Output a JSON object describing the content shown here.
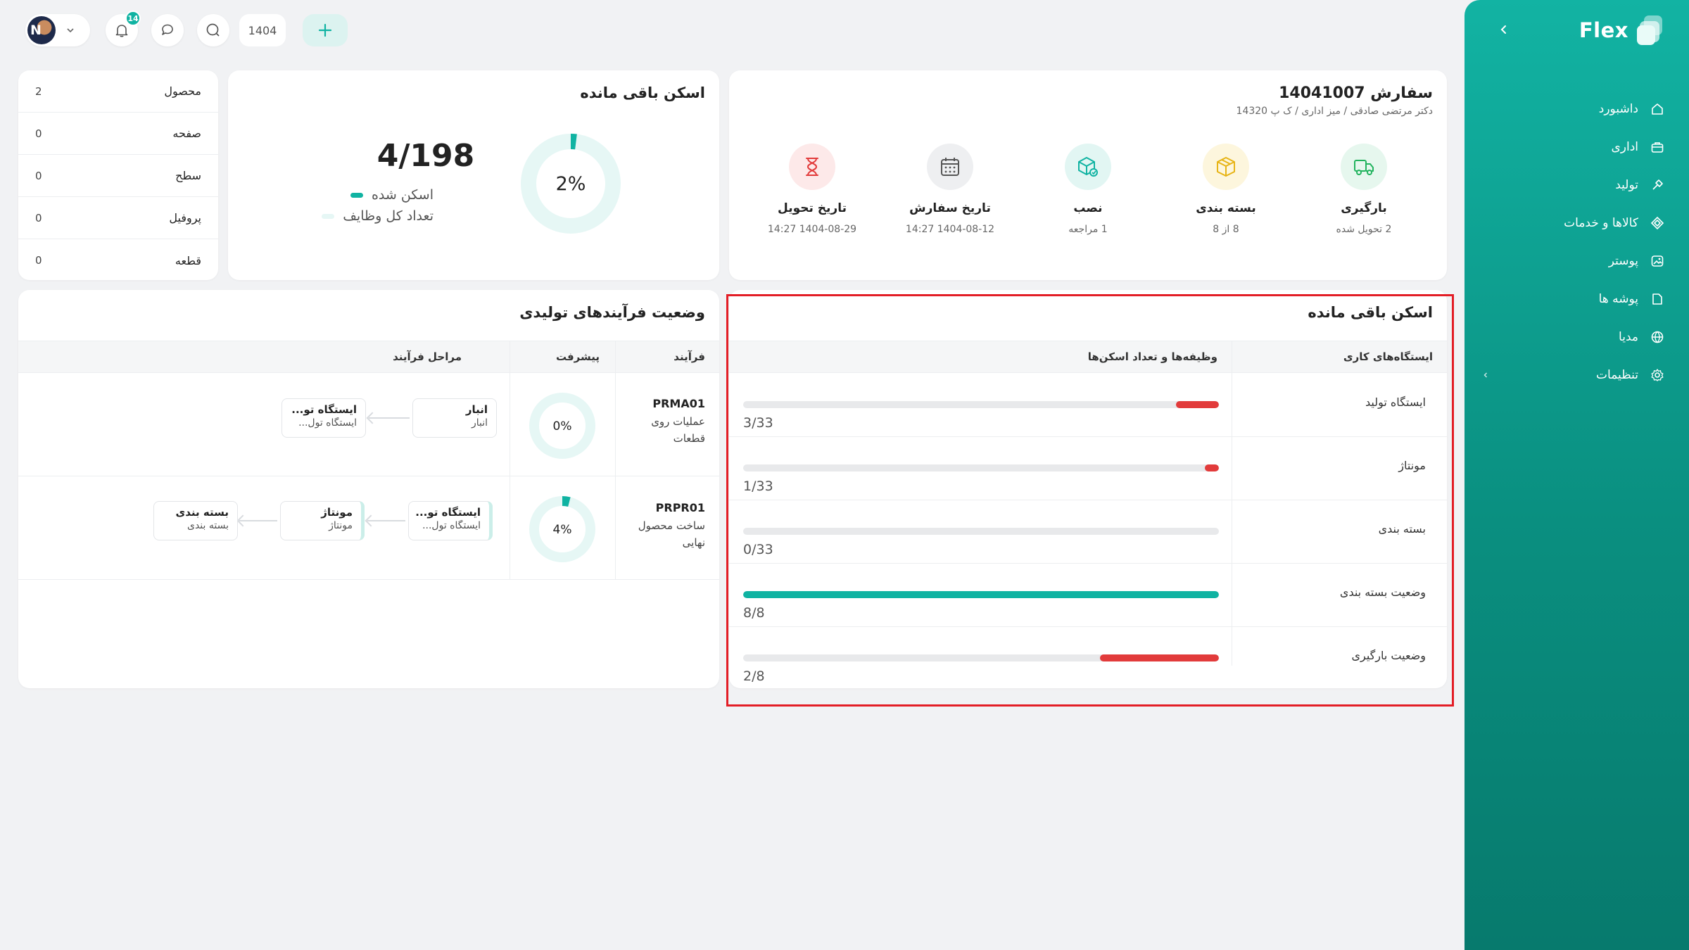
{
  "sidebar": {
    "brand": "Flex",
    "items": [
      {
        "label": "داشبورد",
        "icon": "home-icon"
      },
      {
        "label": "اداری",
        "icon": "briefcase-icon"
      },
      {
        "label": "تولید",
        "icon": "tools-icon"
      },
      {
        "label": "کالاها و خدمات",
        "icon": "diamond-icon"
      },
      {
        "label": "پوستر",
        "icon": "image-icon"
      },
      {
        "label": "پوشه ها",
        "icon": "folder-icon"
      },
      {
        "label": "مدیا",
        "icon": "globe-icon"
      },
      {
        "label": "تنظیمات",
        "icon": "settings-icon"
      }
    ]
  },
  "topbar": {
    "notifications_count": "14",
    "year": "1404",
    "avatar_initial": "N"
  },
  "order": {
    "title": "سفارش 14041007",
    "subtitle": "دکتر مرتضی صادقی / میز اداری / ک پ 14320",
    "stats": [
      {
        "title": "بارگیری",
        "sub": "2 تحویل شده",
        "icon": "truck-icon",
        "color": "#22b35e",
        "bg": "#e6f7ee"
      },
      {
        "title": "بسته بندی",
        "sub": "8 از 8",
        "icon": "box-icon",
        "color": "#e7b416",
        "bg": "#fdf6dd"
      },
      {
        "title": "نصب",
        "sub": "1 مراجعه",
        "icon": "install-icon",
        "color": "#10b3a2",
        "bg": "#e2f6f3"
      },
      {
        "title": "تاریخ سفارش",
        "sub": "1404-08-12 14:27",
        "icon": "calendar-icon",
        "color": "#555555",
        "bg": "#eeeff1"
      },
      {
        "title": "تاریخ تحویل",
        "sub": "1404-08-29 14:27",
        "icon": "hourglass-icon",
        "color": "#e23b3b",
        "bg": "#fde9e9"
      }
    ]
  },
  "remaining": {
    "title": "اسکن باقی مانده",
    "ratio": "4/198",
    "percent": "2%",
    "percent_value": 0.02,
    "legend_scanned": "اسکن شده",
    "legend_total": "تعداد کل وظایف",
    "color_scanned": "#10b3a2",
    "color_total": "#e6f7f5"
  },
  "mini_table": [
    {
      "label": "محصول",
      "value": "2"
    },
    {
      "label": "صفحه",
      "value": "0"
    },
    {
      "label": "سطح",
      "value": "0"
    },
    {
      "label": "پروفیل",
      "value": "0"
    },
    {
      "label": "قطعه",
      "value": "0"
    }
  ],
  "processes": {
    "title": "وضعیت فرآیندهای تولیدی",
    "headers": {
      "process": "فرآیند",
      "progress": "پیشرفت",
      "stages": "مراحل فرآیند"
    },
    "rows": [
      {
        "code": "PRMA01",
        "name_line1": "عملیات    روی",
        "name_line2": "قطعات",
        "percent": "0%",
        "percent_value": 0.0,
        "stages": [
          {
            "t1": "انبار",
            "t2": "انبار"
          },
          {
            "t1": "ایستگاه تو...",
            "t2": "ایستگاه تول..."
          }
        ]
      },
      {
        "code": "PRPR01",
        "name_line1": "ساخت    محصول",
        "name_line2": "نهایی",
        "percent": "4%",
        "percent_value": 0.04,
        "stages": [
          {
            "t1": "ایستگاه تو...",
            "t2": "ایستگاه تول..."
          },
          {
            "t1": "مونتاژ",
            "t2": "مونتاژ"
          },
          {
            "t1": "بسته بندی",
            "t2": "بسته بندی"
          }
        ]
      }
    ]
  },
  "scan_table": {
    "title": "اسکن باقی مانده",
    "headers": {
      "stations": "ایستگاه‌های کاری",
      "tasks": "وظیفه‌ها و تعداد اسکن‌ها"
    },
    "rows": [
      {
        "station": "ایستگاه تولید",
        "count": "3/33",
        "value": 0.0909,
        "color": "#e23b3b"
      },
      {
        "station": "مونتاژ",
        "count": "1/33",
        "value": 0.0303,
        "color": "#e23b3b"
      },
      {
        "station": "بسته بندی",
        "count": "0/33",
        "value": 0.0,
        "color": "#e23b3b"
      },
      {
        "station": "وضعیت بسته بندی",
        "count": "8/8",
        "value": 1.0,
        "color": "#10b3a2"
      },
      {
        "station": "وضعیت بارگیری",
        "count": "2/8",
        "value": 0.25,
        "color": "#e23b3b"
      }
    ]
  }
}
